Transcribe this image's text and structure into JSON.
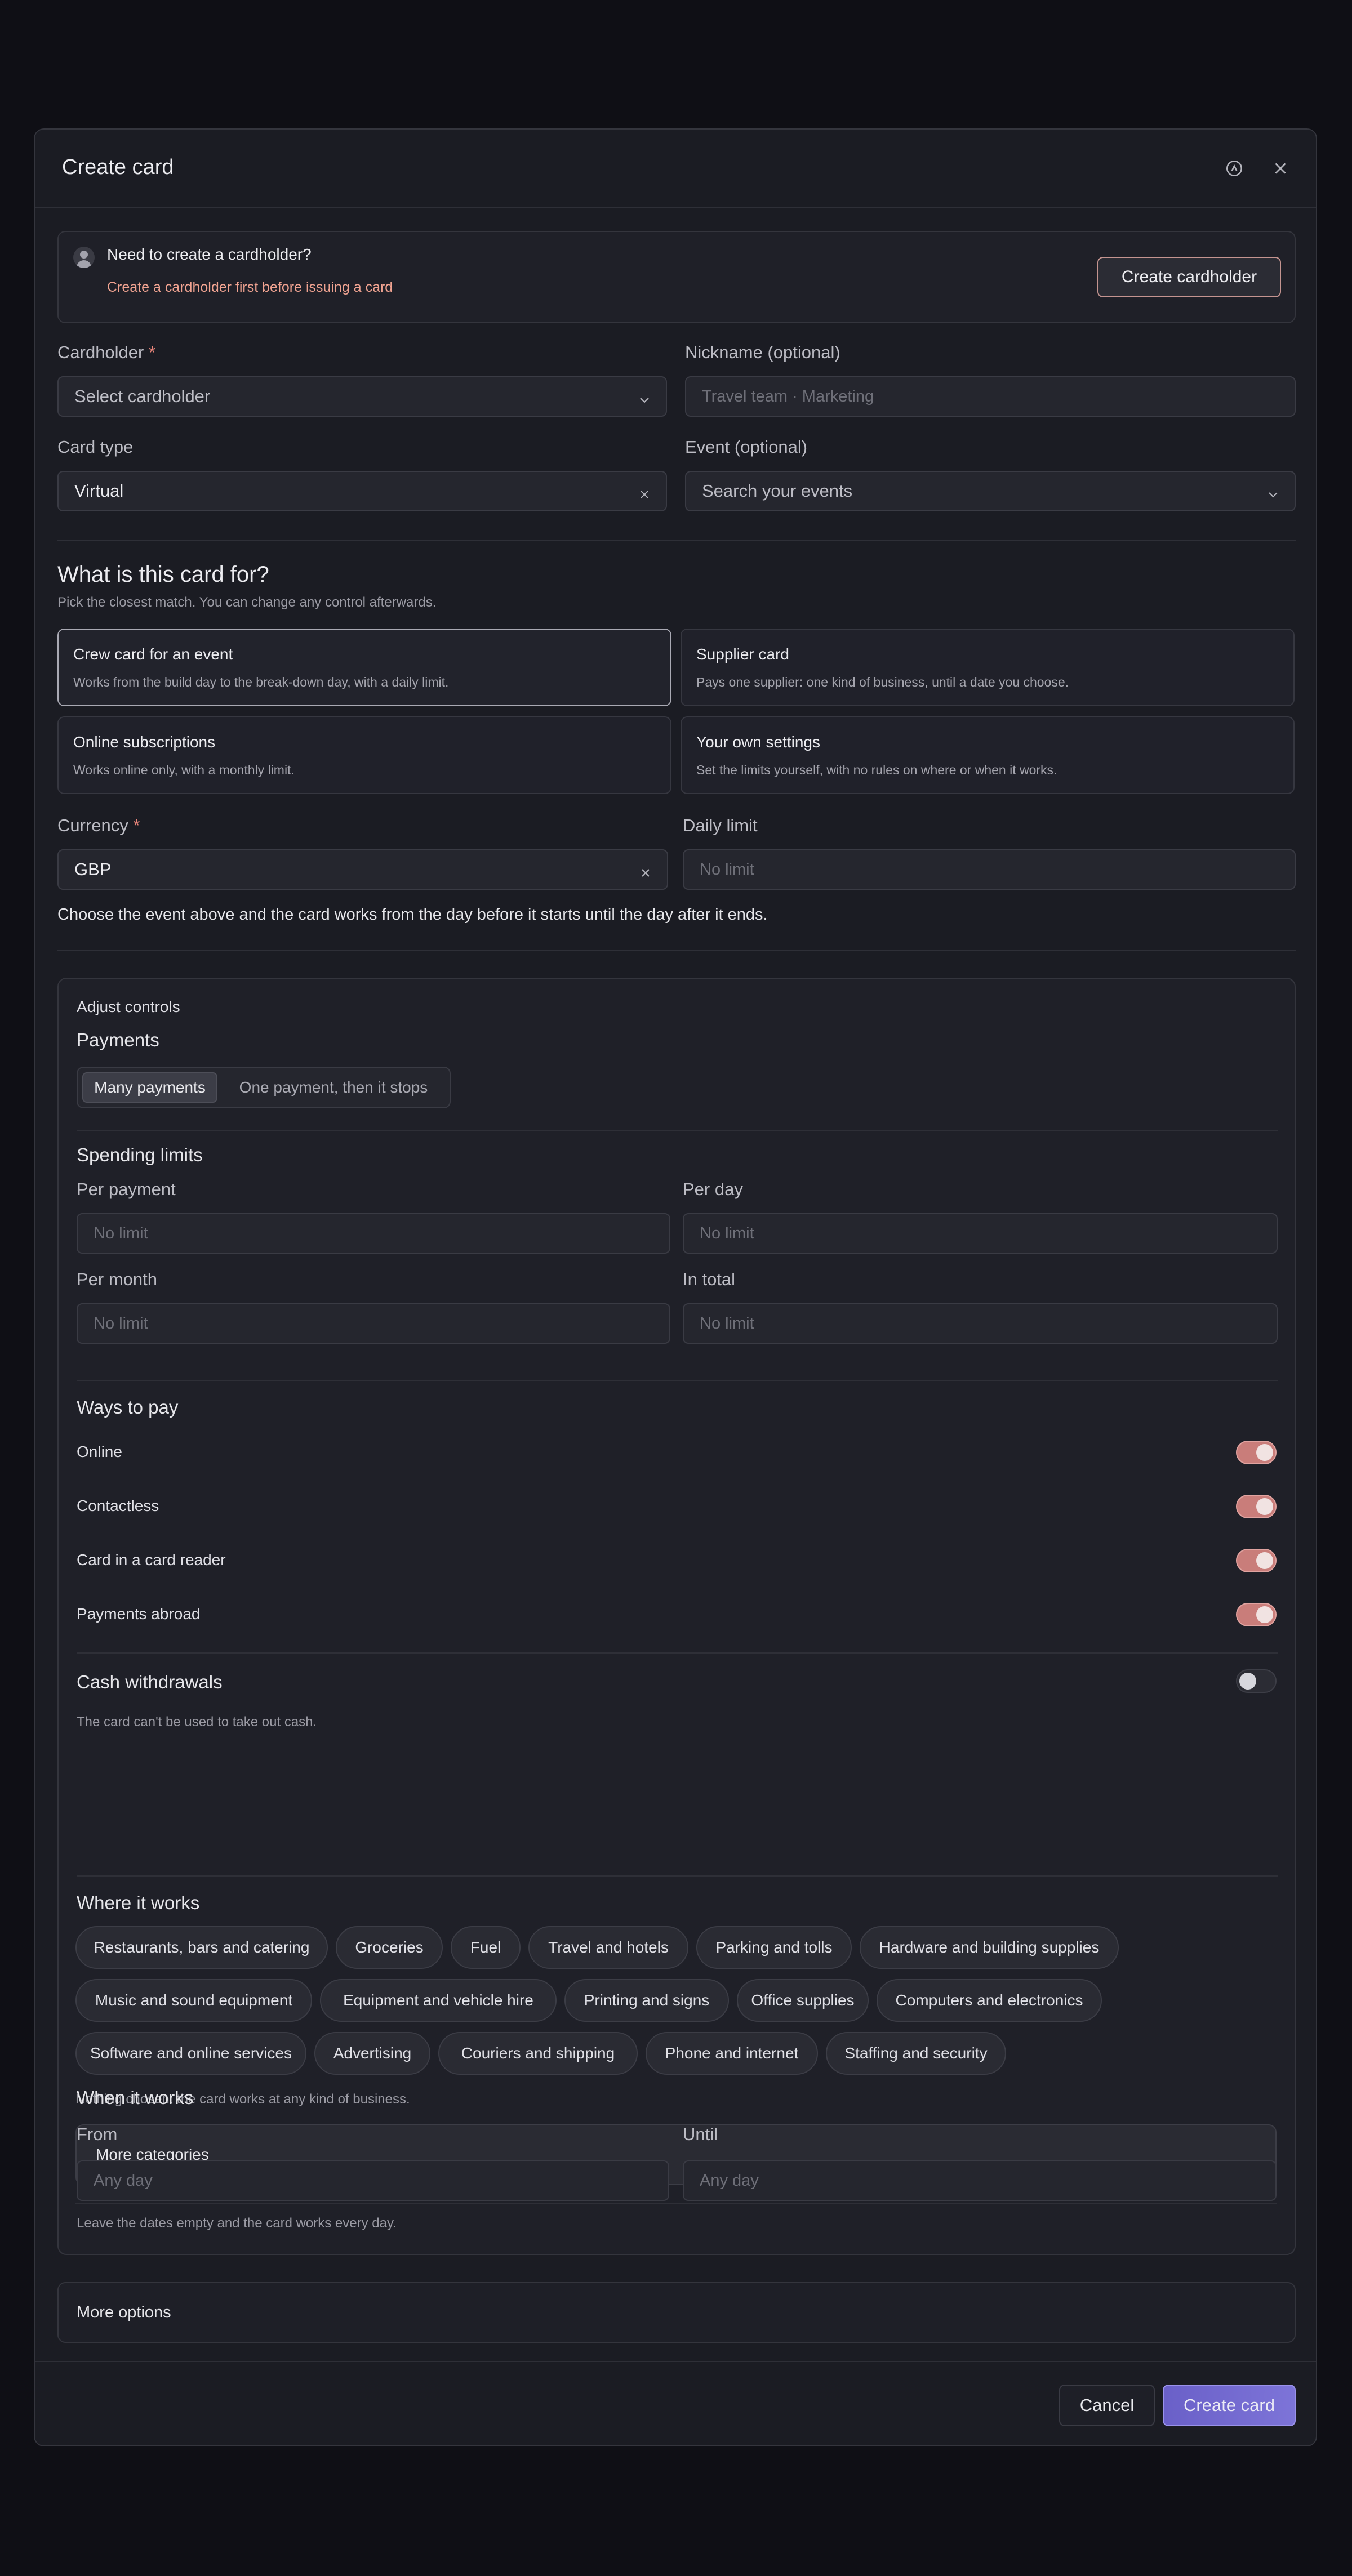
{
  "modal": {
    "title": "Create card",
    "header_icons": [
      "help-icon",
      "close-icon"
    ]
  },
  "banner": {
    "title": "Need to create a cardholder?",
    "subtitle": "Create a cardholder first before issuing a card",
    "button_label": "Create cardholder",
    "accent_color": "#f0a391"
  },
  "form": {
    "cardholder_label": "Cardholder",
    "required_mark": "*",
    "cardholder_placeholder": "Select cardholder",
    "nickname_label": "Nickname (optional)",
    "nickname_placeholder": "Travel team · Marketing",
    "card_type_label": "Card type",
    "card_type_value": "Virtual",
    "event_label": "Event (optional)",
    "event_placeholder": "Search your events"
  },
  "purpose": {
    "heading": "What is this card for?",
    "subtitle": "Pick the closest match. You can change any control afterwards.",
    "options": [
      {
        "title": "Crew card for an event",
        "desc": "Works from the build day to the break-down day, with a daily limit.",
        "selected": true
      },
      {
        "title": "Supplier card",
        "desc": "Pays one supplier: one kind of business, until a date you choose.",
        "selected": false
      },
      {
        "title": "Online subscriptions",
        "desc": "Works online only, with a monthly limit.",
        "selected": false
      },
      {
        "title": "Your own settings",
        "desc": "Set the limits yourself, with no rules on where or when it works.",
        "selected": false
      }
    ]
  },
  "currency": {
    "label": "Currency",
    "value": "GBP",
    "daily_label": "Daily limit",
    "daily_placeholder": "No limit",
    "hint": "Choose the event above and the card works from the day before it starts until the day after it ends."
  },
  "controls": {
    "title": "Adjust controls",
    "payments": {
      "heading": "Payments",
      "options": [
        "Many payments",
        "One payment, then it stops"
      ],
      "selected": "Many payments"
    },
    "limits": {
      "heading": "Spending limits",
      "per_payment_label": "Per payment",
      "per_day_label": "Per day",
      "per_month_label": "Per month",
      "in_total_label": "In total",
      "placeholder": "No limit"
    },
    "ways": {
      "heading": "Ways to pay",
      "items": [
        {
          "label": "Online",
          "on": true
        },
        {
          "label": "Contactless",
          "on": true
        },
        {
          "label": "Card in a card reader",
          "on": true
        },
        {
          "label": "Payments abroad",
          "on": true
        }
      ],
      "toggle_on_color": "#c97d7a"
    },
    "cash": {
      "heading": "Cash withdrawals",
      "on": false,
      "note": "The card can't be used to take out cash."
    },
    "where": {
      "heading": "Where it works",
      "categories": [
        "Restaurants, bars and catering",
        "Groceries",
        "Fuel",
        "Travel and hotels",
        "Parking and tolls",
        "Hardware and building supplies",
        "Music and sound equipment",
        "Equipment and vehicle hire",
        "Printing and signs",
        "Office supplies",
        "Computers and electronics",
        "Software and online services",
        "Advertising",
        "Couriers and shipping",
        "Phone and internet",
        "Staffing and security"
      ],
      "note": "Nothing chosen: the card works at any kind of business.",
      "more_label": "More categories"
    },
    "when": {
      "heading": "When it works",
      "from_label": "From",
      "until_label": "Until",
      "placeholder": "Any day",
      "note": "Leave the dates empty and the card works every day."
    }
  },
  "more_options_label": "More options",
  "footer": {
    "cancel_label": "Cancel",
    "create_label": "Create card",
    "primary_color": "#6a60c8"
  }
}
